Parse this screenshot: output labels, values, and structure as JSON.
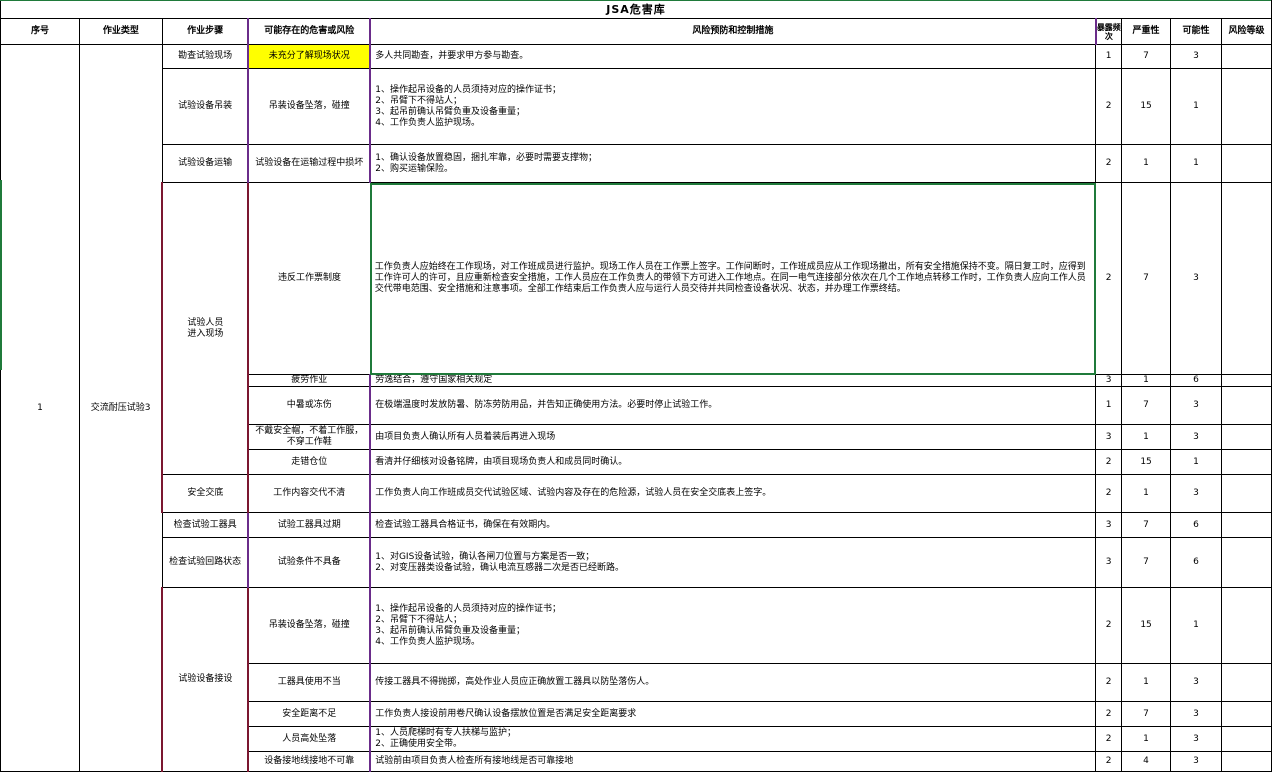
{
  "title": "JSA危害库",
  "headers": {
    "seq": "序号",
    "work_type": "作业类型",
    "step": "作业步骤",
    "hazard": "可能存在的危害或风险",
    "measures": "风险预防和控制措施",
    "exposure": "暴露频次",
    "severity": "严重性",
    "possibility": "可能性",
    "risk_level": "风险等级"
  },
  "seq": "1",
  "work_type": "交流耐压试验3",
  "steps": [
    {
      "label": "勘查试验现场"
    },
    {
      "label": "试验设备吊装"
    },
    {
      "label": "试验设备运输"
    },
    {
      "label": "试验人员\n进入现场"
    },
    {
      "label": "安全交底"
    },
    {
      "label": "检查试验工器具"
    },
    {
      "label": "检查试验回路状态"
    },
    {
      "label": "试验设备接设"
    }
  ],
  "rows": [
    {
      "hazard": "未充分了解现场状况",
      "measure": "多人共同勘查，并要求甲方参与勘查。",
      "e": "1",
      "s": "7",
      "p": "3"
    },
    {
      "hazard": "吊装设备坠落，碰撞",
      "measure": "1、操作起吊设备的人员须持对应的操作证书；\n2、吊臂下不得站人；\n3、起吊前确认吊臂负重及设备重量；\n4、工作负责人监护现场。",
      "e": "2",
      "s": "15",
      "p": "1"
    },
    {
      "hazard": "试验设备在运输过程中损坏",
      "measure": "1、确认设备放置稳固，捆扎牢靠，必要时需要支撑物；\n2、购买运输保险。",
      "e": "2",
      "s": "1",
      "p": "1"
    },
    {
      "hazard": "违反工作票制度",
      "measure": "工作负责人应始终在工作现场，对工作班成员进行监护。现场工作人员在工作票上签字。工作间断时，工作班成员应从工作现场撤出，所有安全措施保持不变。隔日复工时，应得到工作许可人的许可，且应重新检查安全措施，工作人员应在工作负责人的带领下方可进入工作地点。在同一电气连接部分依次在几个工作地点转移工作时，工作负责人应向工作人员交代带电范围、安全措施和注意事项。全部工作结束后工作负责人应与运行人员交待并共同检查设备状况、状态，并办理工作票终结。",
      "e": "2",
      "s": "7",
      "p": "3"
    },
    {
      "hazard": "疲劳作业",
      "measure": "劳逸结合，遵守国家相关规定",
      "e": "3",
      "s": "1",
      "p": "6"
    },
    {
      "hazard": "中暑或冻伤",
      "measure": "在极端温度时发放防暑、防冻劳防用品，并告知正确使用方法。必要时停止试验工作。",
      "e": "1",
      "s": "7",
      "p": "3"
    },
    {
      "hazard": "不戴安全帽，不着工作服，不穿工作鞋",
      "measure": "由项目负责人确认所有人员着装后再进入现场",
      "e": "3",
      "s": "1",
      "p": "3"
    },
    {
      "hazard": "走错仓位",
      "measure": "看清并仔细核对设备铭牌，由项目现场负责人和成员同时确认。",
      "e": "2",
      "s": "15",
      "p": "1"
    },
    {
      "hazard": "工作内容交代不清",
      "measure": "工作负责人向工作班成员交代试验区域、试验内容及存在的危险源，试验人员在安全交底表上签字。",
      "e": "2",
      "s": "1",
      "p": "3"
    },
    {
      "hazard": "试验工器具过期",
      "measure": "检查试验工器具合格证书，确保在有效期内。",
      "e": "3",
      "s": "7",
      "p": "6"
    },
    {
      "hazard": "试验条件不具备",
      "measure": "1、对GIS设备试验，确认各闸刀位置与方案是否一致；\n2、对变压器类设备试验，确认电流互感器二次是否已经断路。",
      "e": "3",
      "s": "7",
      "p": "6"
    },
    {
      "hazard": "吊装设备坠落，碰撞",
      "measure": "1、操作起吊设备的人员须持对应的操作证书；\n2、吊臂下不得站人；\n3、起吊前确认吊臂负重及设备重量；\n4、工作负责人监护现场。",
      "e": "2",
      "s": "15",
      "p": "1"
    },
    {
      "hazard": "工器具使用不当",
      "measure": "传接工器具不得抛掷，高处作业人员应正确放置工器具以防坠落伤人。",
      "e": "2",
      "s": "1",
      "p": "3"
    },
    {
      "hazard": "安全距离不足",
      "measure": "工作负责人接设前用卷尺确认设备摆放位置是否满足安全距离要求",
      "e": "2",
      "s": "7",
      "p": "3"
    },
    {
      "hazard": "人员高处坠落",
      "measure": "1、人员爬梯时有专人扶梯与监护；\n2、正确使用安全带。",
      "e": "2",
      "s": "1",
      "p": "3"
    },
    {
      "hazard": "设备接地线接地不可靠",
      "measure": "试验前由项目负责人检查所有接地线是否可靠接地",
      "e": "2",
      "s": "4",
      "p": "3"
    }
  ]
}
